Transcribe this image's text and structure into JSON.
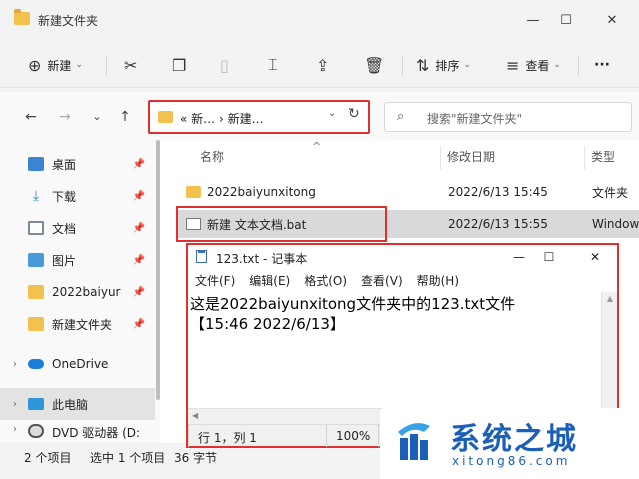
{
  "explorer": {
    "title": "新建文件夹",
    "toolbar": {
      "new_label": "新建",
      "sort_label": "排序",
      "view_label": "查看",
      "more_label": "···"
    },
    "nav": {
      "back": "←",
      "forward": "→",
      "expand": "⌄",
      "up": "↑"
    },
    "address": {
      "path": "« 新…  ›  新建…",
      "caret": "⌄",
      "refresh": "↻"
    },
    "search": {
      "placeholder": "搜索\"新建文件夹\""
    },
    "sidebar": {
      "items": [
        {
          "label": "桌面"
        },
        {
          "label": "下载"
        },
        {
          "label": "文档"
        },
        {
          "label": "图片"
        },
        {
          "label": "2022baiyur"
        },
        {
          "label": "新建文件夹"
        },
        {
          "label": "OneDrive"
        },
        {
          "label": "此电脑"
        },
        {
          "label": "DVD 驱动器 (D:"
        }
      ]
    },
    "columns": {
      "name": "名称",
      "date": "修改日期",
      "type": "类型"
    },
    "files": [
      {
        "name": "2022baiyunxitong",
        "date": "2022/6/13 15:45",
        "type": "文件夹"
      },
      {
        "name": "新建 文本文档.bat",
        "date": "2022/6/13 15:55",
        "type": "Windows"
      }
    ],
    "status": {
      "count": "2 个项目",
      "selection": "选中 1 个项目",
      "size": "36 字节"
    }
  },
  "notepad": {
    "title": "123.txt - 记事本",
    "controls": {
      "minimize": "—",
      "maximize": "☐",
      "close": "✕"
    },
    "menu": [
      "文件(F)",
      "编辑(E)",
      "格式(O)",
      "查看(V)",
      "帮助(H)"
    ],
    "content_line1": "这是2022baiyunxitong文件夹中的123.txt文件",
    "content_line2": "【15:46 2022/6/13】",
    "status": {
      "position": "行 1，列 1",
      "zoom": "100%"
    }
  },
  "watermark": {
    "cn": "系统之城",
    "url": "xitong86.com"
  }
}
